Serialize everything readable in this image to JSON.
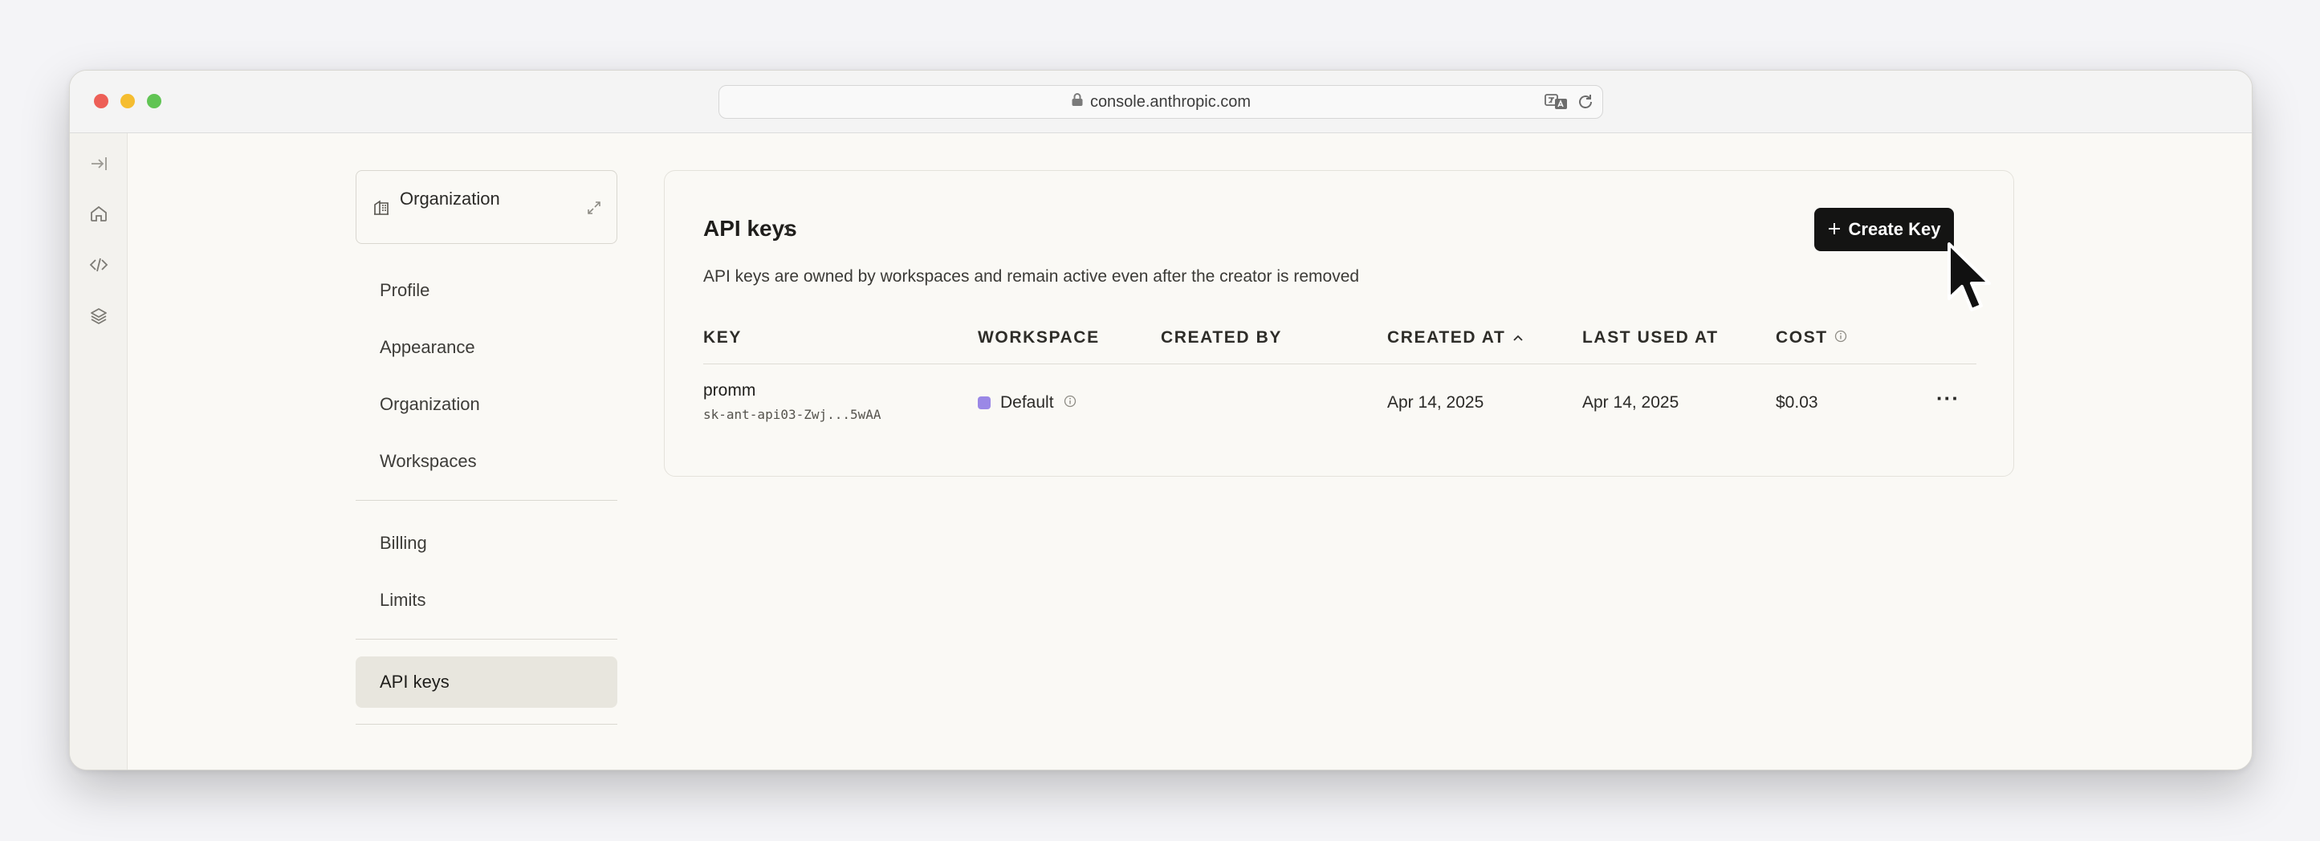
{
  "browser": {
    "url": "console.anthropic.com"
  },
  "sidebar": {
    "org_selector_label": "Organization",
    "group1": [
      "Profile",
      "Appearance",
      "Organization",
      "Workspaces"
    ],
    "group2": [
      "Billing",
      "Limits"
    ],
    "active_item": "API keys"
  },
  "card": {
    "title": "API keys",
    "count": "1",
    "create_button": "Create Key",
    "description": "API keys are owned by workspaces and remain active even after the creator is removed",
    "columns": {
      "key": "KEY",
      "workspace": "WORKSPACE",
      "created_by": "CREATED BY",
      "created_at": "CREATED AT",
      "last_used_at": "LAST USED AT",
      "cost": "COST"
    },
    "rows": [
      {
        "name": "promm",
        "key_id": "sk-ant-api03-Zwj...5wAA",
        "workspace": "Default",
        "created_by": "",
        "created_at": "Apr 14, 2025",
        "last_used_at": "Apr 14, 2025",
        "cost": "$0.03",
        "actions": "···"
      }
    ]
  },
  "colors": {
    "primary_button": "#141413",
    "workspace_swatch": "#9a88e6",
    "page_background": "#faf9f5"
  }
}
